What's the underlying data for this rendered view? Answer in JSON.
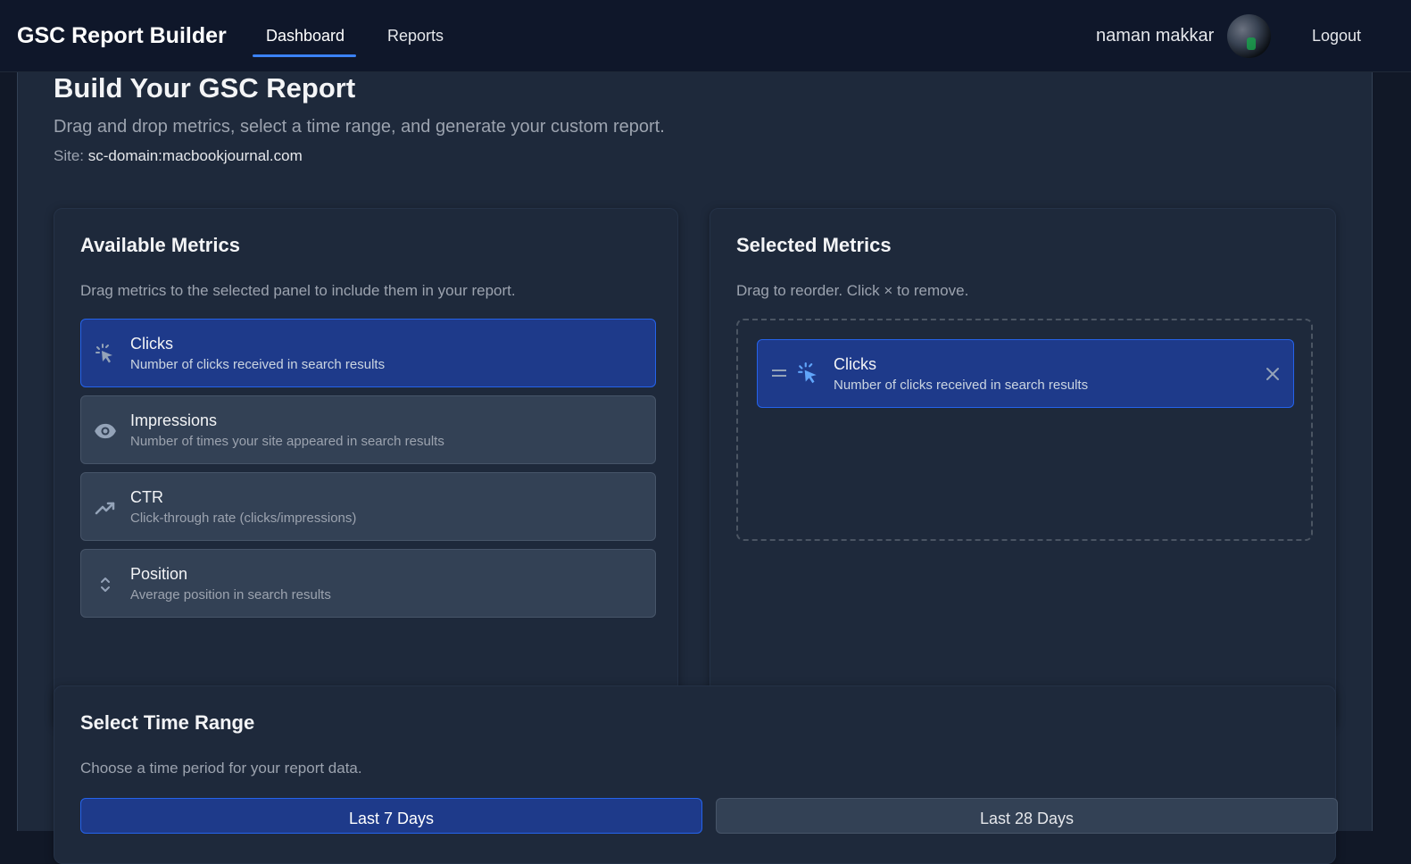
{
  "app": {
    "title": "GSC Report Builder"
  },
  "nav": {
    "tabs": [
      {
        "label": "Dashboard",
        "active": true
      },
      {
        "label": "Reports",
        "active": false
      }
    ],
    "user_name": "naman makkar",
    "logout_label": "Logout"
  },
  "page": {
    "title": "Build Your GSC Report",
    "subtitle": "Drag and drop metrics, select a time range, and generate your custom report.",
    "site_label": "Site:",
    "site_value": "sc-domain:macbookjournal.com"
  },
  "available": {
    "title": "Available Metrics",
    "description": "Drag metrics to the selected panel to include them in your report.",
    "metrics": [
      {
        "name": "Clicks",
        "description": "Number of clicks received in search results",
        "icon": "cursor-click-icon",
        "selected": true
      },
      {
        "name": "Impressions",
        "description": "Number of times your site appeared in search results",
        "icon": "eye-icon",
        "selected": false
      },
      {
        "name": "CTR",
        "description": "Click-through rate (clicks/impressions)",
        "icon": "trending-up-icon",
        "selected": false
      },
      {
        "name": "Position",
        "description": "Average position in search results",
        "icon": "up-down-chevron-icon",
        "selected": false
      }
    ]
  },
  "selected": {
    "title": "Selected Metrics",
    "description": "Drag to reorder. Click × to remove.",
    "items": [
      {
        "name": "Clicks",
        "description": "Number of clicks received in search results",
        "icon": "cursor-click-icon"
      }
    ]
  },
  "time_range": {
    "title": "Select Time Range",
    "description": "Choose a time period for your report data.",
    "options": [
      {
        "label": "Last 7 Days",
        "active": true
      },
      {
        "label": "Last 28 Days",
        "active": false
      }
    ]
  },
  "colors": {
    "accent": "#2563eb",
    "selected_bg": "#1e3a8a",
    "background": "#1e293b"
  }
}
